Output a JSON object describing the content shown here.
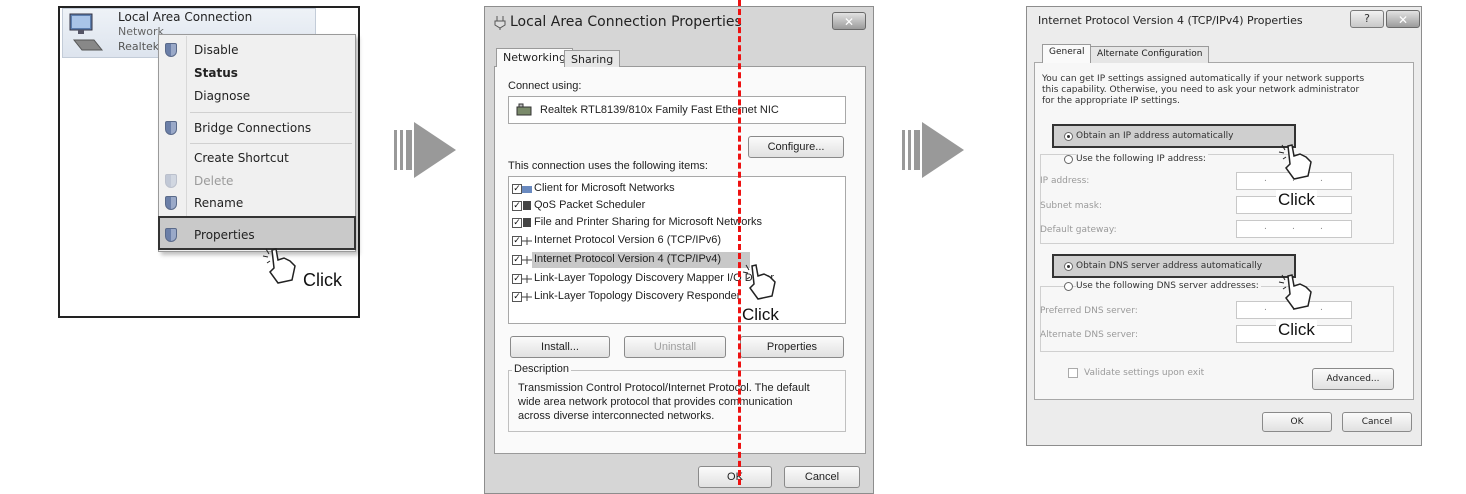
{
  "panel1": {
    "connection_name": "Local Area Connection",
    "connection_sub": "Network",
    "adapter_short": "Realtek",
    "menu_items": [
      {
        "label": "Disable",
        "bold": false,
        "disabled": false,
        "shield": true
      },
      {
        "label": "Status",
        "bold": true,
        "disabled": false,
        "shield": false
      },
      {
        "label": "Diagnose",
        "bold": false,
        "disabled": false,
        "shield": false
      },
      {
        "label": "Bridge Connections",
        "bold": false,
        "disabled": false,
        "shield": true
      },
      {
        "label": "Create Shortcut",
        "bold": false,
        "disabled": false,
        "shield": false
      },
      {
        "label": "Delete",
        "bold": false,
        "disabled": true,
        "shield": true
      },
      {
        "label": "Rename",
        "bold": false,
        "disabled": false,
        "shield": true
      },
      {
        "label": "Properties",
        "bold": false,
        "disabled": false,
        "shield": true
      }
    ],
    "click_label": "Click"
  },
  "panel2": {
    "title": "Local Area Connection Properties",
    "close_glyph": "✕",
    "tabs": [
      "Networking",
      "Sharing"
    ],
    "connect_using_label": "Connect using:",
    "adapter_name": "Realtek RTL8139/810x Family Fast Ethernet NIC",
    "configure_button": "Configure...",
    "items_label": "This connection uses the following items:",
    "items": [
      {
        "label": "Client for Microsoft Networks",
        "checked": true
      },
      {
        "label": "QoS Packet Scheduler",
        "checked": true
      },
      {
        "label": "File and Printer Sharing for Microsoft Networks",
        "checked": true
      },
      {
        "label": "Internet Protocol Version 6 (TCP/IPv6)",
        "checked": true
      },
      {
        "label": "Internet Protocol Version 4 (TCP/IPv4)",
        "checked": true
      },
      {
        "label": "Link-Layer Topology Discovery Mapper I/O Driver",
        "checked": true
      },
      {
        "label": "Link-Layer Topology Discovery Responder",
        "checked": true
      }
    ],
    "install_button": "Install...",
    "uninstall_button": "Uninstall",
    "properties_button": "Properties",
    "description_label": "Description",
    "description_lines": [
      "Transmission Control Protocol/Internet Protocol. The default",
      "wide area network protocol that provides communication",
      "across diverse interconnected networks."
    ],
    "ok_button": "OK",
    "cancel_button": "Cancel",
    "click_label": "Click"
  },
  "panel3": {
    "title": "Internet Protocol Version 4 (TCP/IPv4) Properties",
    "help_glyph": "?",
    "close_glyph": "✕",
    "tabs": [
      "General",
      "Alternate Configuration"
    ],
    "intro_lines": [
      "You can get IP settings assigned automatically if your network supports",
      "this capability. Otherwise, you need to ask your network administrator",
      "for the appropriate IP settings."
    ],
    "obtain_ip_auto": "Obtain an IP address automatically",
    "use_following_ip": "Use the following IP address:",
    "ip_address_label": "IP address:",
    "subnet_mask_label": "Subnet mask:",
    "default_gateway_label": "Default gateway:",
    "obtain_dns_auto": "Obtain DNS server address automatically",
    "use_following_dns": "Use the following DNS server addresses:",
    "preferred_dns_label": "Preferred DNS server:",
    "alternate_dns_label": "Alternate DNS server:",
    "validate_label": "Validate settings upon exit",
    "advanced_button": "Advanced...",
    "ok_button": "OK",
    "cancel_button": "Cancel",
    "click_label_1": "Click",
    "click_label_2": "Click"
  }
}
